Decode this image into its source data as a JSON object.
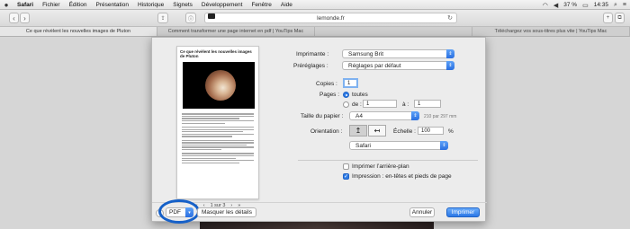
{
  "menubar": {
    "apple": "",
    "items": [
      "Safari",
      "Fichier",
      "Édition",
      "Présentation",
      "Historique",
      "Signets",
      "Développement",
      "Fenêtre",
      "Aide"
    ],
    "battery": "37 %",
    "clock": "14:35"
  },
  "toolbar": {
    "url": "lemonde.fr"
  },
  "tabs": [
    {
      "label": "Ce que révèlent les nouvelles images de Pluton",
      "active": true
    },
    {
      "label": "Comment transformer une page internet en pdf | YouTips Mac",
      "active": false
    },
    {
      "label": "",
      "active": false
    },
    {
      "label": "Téléchargez vos sous-titres plus vite | YouTips Mac",
      "active": false
    }
  ],
  "preview": {
    "title": "Ce que révèlent les nouvelles images de Pluton",
    "page_indicator": "1 sur 3"
  },
  "print": {
    "printer_label": "Imprimante :",
    "printer_value": "Samsung Brit",
    "presets_label": "Préréglages :",
    "presets_value": "Réglages par défaut",
    "copies_label": "Copies :",
    "copies_value": "1",
    "pages_label": "Pages :",
    "pages_all": "toutes",
    "pages_from": "de :",
    "pages_from_value": "1",
    "pages_to": "à :",
    "pages_to_value": "1",
    "paper_label": "Taille du papier :",
    "paper_value": "A4",
    "paper_dims": "210 par 297 mm",
    "orientation_label": "Orientation :",
    "scale_label": "Échelle :",
    "scale_value": "100",
    "scale_unit": "%",
    "app_section": "Safari",
    "bg_label": "Imprimer l’arrière-plan",
    "headers_label": "Impression : en-têtes et pieds de page",
    "pdf_label": "PDF",
    "hide_details": "Masquer les détails",
    "cancel": "Annuler",
    "print": "Imprimer"
  },
  "colors": {
    "accent": "#2f7ce6",
    "highlight_ring": "#1560c8"
  }
}
